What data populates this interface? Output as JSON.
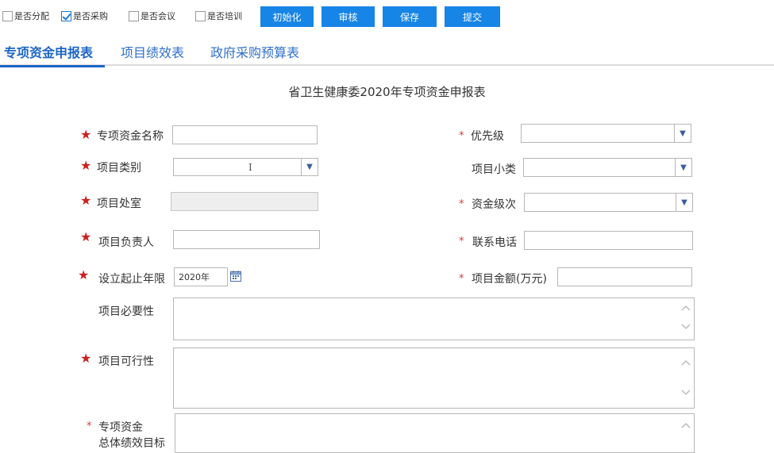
{
  "toolbar": {
    "checkboxes": [
      {
        "label": "是否分配",
        "checked": false
      },
      {
        "label": "是否采购",
        "checked": true
      },
      {
        "label": "是否会议",
        "checked": false
      },
      {
        "label": "是否培训",
        "checked": false
      }
    ],
    "buttons": [
      {
        "label": "初始化"
      },
      {
        "label": "审核"
      },
      {
        "label": "保存"
      },
      {
        "label": "提交"
      }
    ]
  },
  "tabs": [
    {
      "label": "专项资金申报表",
      "active": true
    },
    {
      "label": "项目绩效表",
      "active": false
    },
    {
      "label": "政府采购预算表",
      "active": false
    }
  ],
  "form": {
    "title": "省卫生健康委2020年专项资金申报表",
    "fields": {
      "fund_name": {
        "label": "专项资金名称",
        "value": ""
      },
      "project_category": {
        "label": "项目类别",
        "value": ""
      },
      "project_office": {
        "label": "项目处室",
        "value": ""
      },
      "project_leader": {
        "label": "项目负责人",
        "value": ""
      },
      "period": {
        "label": "设立起止年限",
        "value": "2020年"
      },
      "necessity": {
        "label": "项目必要性",
        "value": ""
      },
      "feasibility": {
        "label": "项目可行性",
        "value": ""
      },
      "fund_goal": {
        "label": "专项资金",
        "label_line2": "总体绩效目标",
        "value": ""
      },
      "priority": {
        "label": "优先级",
        "value": ""
      },
      "subcategory": {
        "label": "项目小类",
        "value": ""
      },
      "fund_level": {
        "label": "资金级次",
        "value": ""
      },
      "phone": {
        "label": "联系电话",
        "value": ""
      },
      "amount": {
        "label": "项目金额(万元)",
        "value": ""
      }
    }
  },
  "colors": {
    "button_blue": "#1685e6",
    "tab_blue": "#1d66c6",
    "required_red": "#cc1f1f"
  }
}
